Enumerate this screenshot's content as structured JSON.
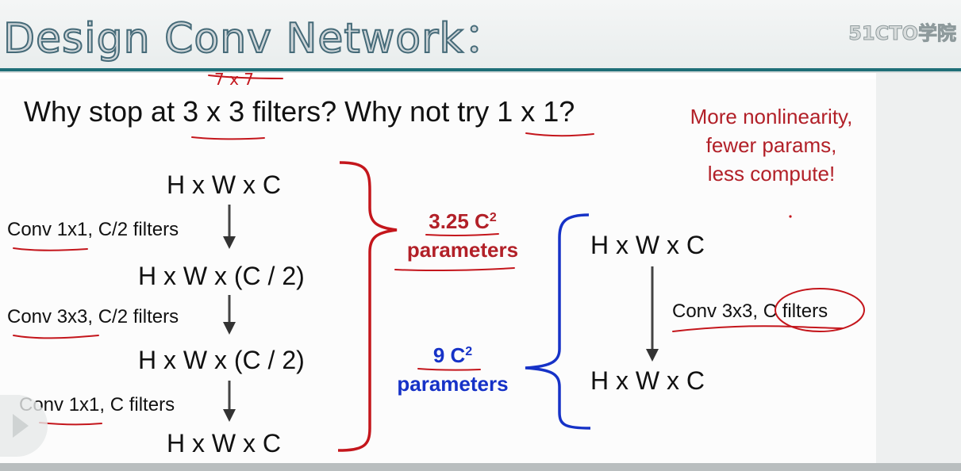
{
  "header": {
    "title": "Design Conv Network：",
    "brand": "51CTO学院"
  },
  "slide": {
    "question": "Why stop at 3 x 3 filters? Why not try 1 x 1?",
    "handwritten_note": "7 x 7",
    "side_note": [
      "More nonlinearity,",
      "fewer params,",
      "less compute!"
    ],
    "left_stack": {
      "dims": [
        "H x W x C",
        "H x W x (C / 2)",
        "H x W x (C / 2)",
        "H x W x C"
      ],
      "convs": [
        "Conv 1x1, C/2 filters",
        "Conv 3x3, C/2 filters",
        "Conv 1x1, C filters"
      ]
    },
    "left_params": {
      "value": "3.25 C",
      "exp": "2",
      "unit": "parameters",
      "color": "#b22028"
    },
    "right_params": {
      "value": "9 C",
      "exp": "2",
      "unit": "parameters",
      "color": "#1632c7"
    },
    "right_stack": {
      "dims": [
        "H x W x C",
        "H x W x C"
      ],
      "conv": "Conv 3x3, C filters"
    }
  },
  "icons": {
    "play": "play-icon"
  },
  "colors": {
    "teal": "#1f6f78",
    "red": "#b22028",
    "blue": "#1632c7"
  }
}
